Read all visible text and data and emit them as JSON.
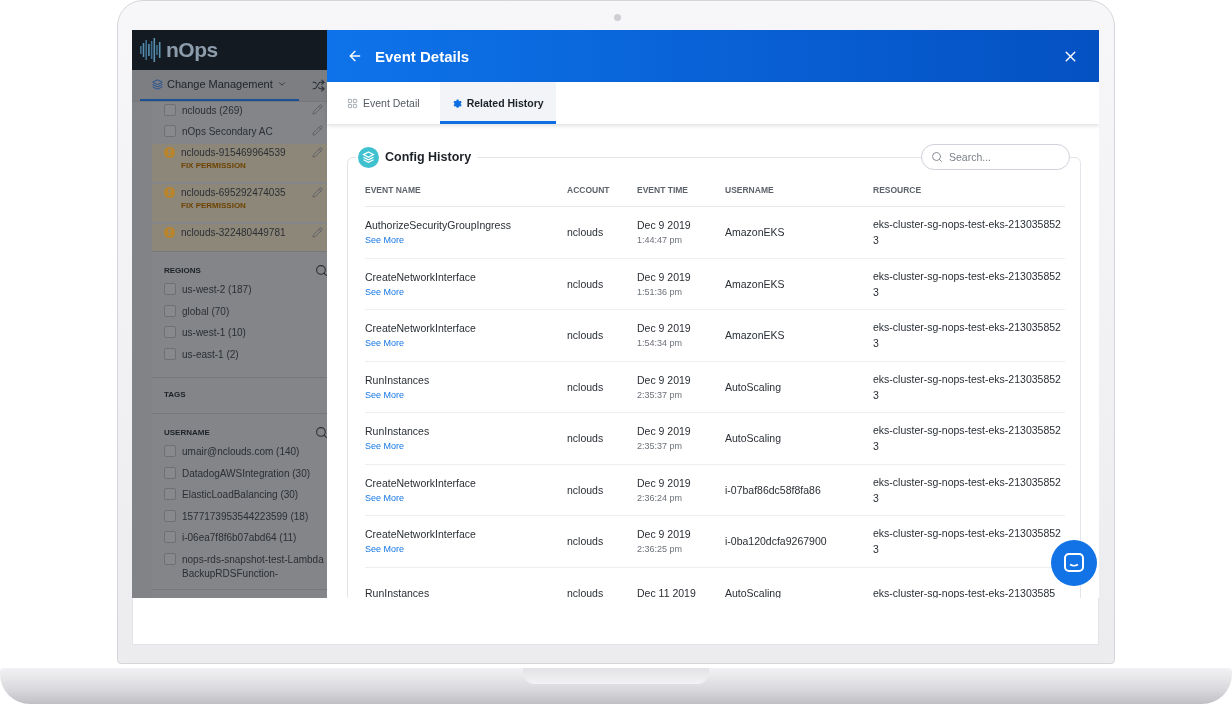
{
  "logo": {
    "text": "nOps"
  },
  "nav": {
    "label": "Change Management"
  },
  "accounts": [
    {
      "kind": "checkbox",
      "label": "nclouds (269)",
      "checked": false
    },
    {
      "kind": "checkbox",
      "label": "nOps Secondary AC",
      "checked": false
    },
    {
      "kind": "warning",
      "label": "nclouds-915469964539",
      "action": "FIX PERMISSION"
    },
    {
      "kind": "warning",
      "label": "nclouds-695292474035",
      "action": "FIX PERMISSION"
    },
    {
      "kind": "warning",
      "label": "nclouds-322480449781"
    }
  ],
  "filters": [
    {
      "title": "REGIONS",
      "searchable": true,
      "items": [
        {
          "label": "us-west-2 (187)",
          "checked": false
        },
        {
          "label": "global (70)",
          "checked": false
        },
        {
          "label": "us-west-1 (10)",
          "checked": false
        },
        {
          "label": "us-east-1 (2)",
          "checked": false
        }
      ]
    },
    {
      "title": "TAGS",
      "searchable": false
    },
    {
      "title": "USERNAME",
      "searchable": true,
      "items": [
        {
          "label": "umair@nclouds.com (140)",
          "checked": false
        },
        {
          "label": "DatadogAWSIntegration (30)",
          "checked": false
        },
        {
          "label": "ElasticLoadBalancing (30)",
          "checked": false
        },
        {
          "label": "1577173953544223599 (18)",
          "checked": false
        },
        {
          "label": "i-06ea7f8f6b07abd64 (11)",
          "checked": false
        },
        {
          "label": "nops-rds-snapshot-test-LambdaBackupRDSFunction-",
          "checked": false
        }
      ]
    }
  ],
  "panel": {
    "title": "Event Details",
    "tabs": [
      {
        "label": "Event Detail",
        "selected": false
      },
      {
        "label": "Related History",
        "selected": true
      }
    ]
  },
  "config_history": {
    "title": "Config History",
    "search": {
      "placeholder": "Search..."
    },
    "columns": [
      "EVENT NAME",
      "ACCOUNT",
      "EVENT TIME",
      "USERNAME",
      "RESOURCE"
    ],
    "rows": [
      {
        "event_name": "AuthorizeSecurityGroupIngress",
        "see_more": "See More",
        "account": "nclouds",
        "date": "Dec 9 2019",
        "time": "1:44:47 pm",
        "username": "AmazonEKS",
        "resource": "eks-cluster-sg-nops-test-eks-2130358523"
      },
      {
        "event_name": "CreateNetworkInterface",
        "see_more": "See More",
        "account": "nclouds",
        "date": "Dec 9 2019",
        "time": "1:51:36 pm",
        "username": "AmazonEKS",
        "resource": "eks-cluster-sg-nops-test-eks-2130358523"
      },
      {
        "event_name": "CreateNetworkInterface",
        "see_more": "See More",
        "account": "nclouds",
        "date": "Dec 9 2019",
        "time": "1:54:34 pm",
        "username": "AmazonEKS",
        "resource": "eks-cluster-sg-nops-test-eks-2130358523"
      },
      {
        "event_name": "RunInstances",
        "see_more": "See More",
        "account": "nclouds",
        "date": "Dec 9 2019",
        "time": "2:35:37 pm",
        "username": "AutoScaling",
        "resource": "eks-cluster-sg-nops-test-eks-2130358523"
      },
      {
        "event_name": "RunInstances",
        "see_more": "See More",
        "account": "nclouds",
        "date": "Dec 9 2019",
        "time": "2:35:37 pm",
        "username": "AutoScaling",
        "resource": "eks-cluster-sg-nops-test-eks-2130358523"
      },
      {
        "event_name": "CreateNetworkInterface",
        "see_more": "See More",
        "account": "nclouds",
        "date": "Dec 9 2019",
        "time": "2:36:24 pm",
        "username": "i-07baf86dc58f8fa86",
        "resource": "eks-cluster-sg-nops-test-eks-2130358523"
      },
      {
        "event_name": "CreateNetworkInterface",
        "see_more": "See More",
        "account": "nclouds",
        "date": "Dec 9 2019",
        "time": "2:36:25 pm",
        "username": "i-0ba120dcfa9267900",
        "resource": "eks-cluster-sg-nops-test-eks-2130358523"
      },
      {
        "event_name": "RunInstances",
        "account": "nclouds",
        "date": "Dec 11 2019",
        "username": "AutoScaling",
        "resource": "eks-cluster-sg-nops-test-eks-21303585"
      }
    ]
  }
}
